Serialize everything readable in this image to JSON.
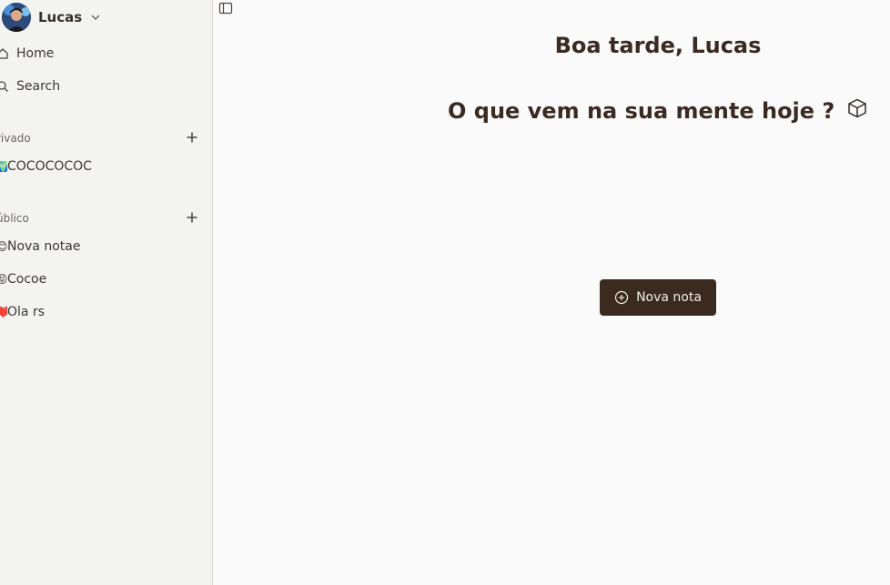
{
  "user": {
    "name": "Lucas"
  },
  "nav": {
    "home": "Home",
    "search": "Search"
  },
  "sections": {
    "private": {
      "label": "rivado",
      "notes": [
        {
          "emoji": "🌍",
          "title": "COCOCOCOC"
        }
      ]
    },
    "public": {
      "label": "úblico",
      "notes": [
        {
          "emoji": "😊",
          "title": "Nova notae"
        },
        {
          "emoji": "😝",
          "title": "Cocoe"
        },
        {
          "emoji": "❤️",
          "title": "Ola rs"
        }
      ]
    }
  },
  "main": {
    "greeting": "Boa tarde, Lucas",
    "prompt": "O que vem na sua mente hoje ?",
    "new_note_label": "Nova nota"
  },
  "icons": {
    "sidebar_toggle": "sidebar-toggle-icon",
    "home": "home-icon",
    "search": "search-icon",
    "add": "plus-icon",
    "chevron": "chevron-down-icon",
    "cube": "cube-icon",
    "new_note": "plus-circle-icon"
  },
  "colors": {
    "accent": "#3b2a20",
    "heading": "#3b2a22",
    "sidebar_bg": "#f3f3f2",
    "main_bg": "#fafafa"
  }
}
